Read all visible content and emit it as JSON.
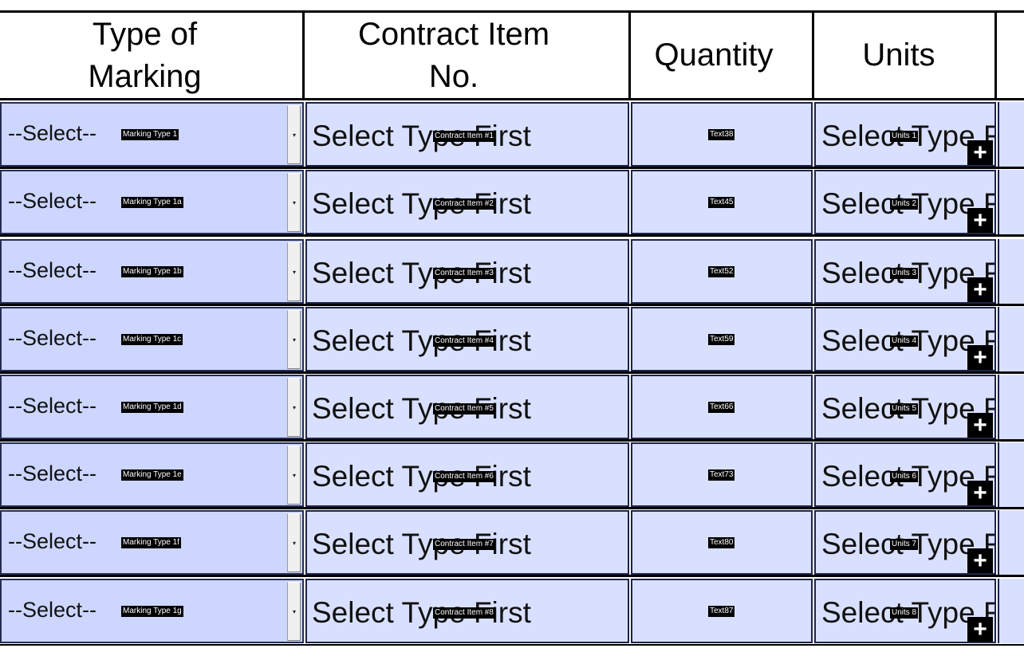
{
  "header": {
    "col_marking": "Type of\nMarking",
    "col_item": "Contract Item\nNo.",
    "col_quantity": "Quantity",
    "col_units": "Units"
  },
  "icons": {
    "dropdown": "chevron-down-icon",
    "add": "plus-icon"
  },
  "colors": {
    "marking_bg": "#ccd6ff",
    "field_bg": "#d9e0ff",
    "border": "#000000"
  },
  "rows": [
    {
      "marking_value": "--Select--",
      "marking_tag": "Marking Type 1",
      "item_placeholder": "Select Type First",
      "item_tag": "Contract Item #1",
      "qty_tag": "Text38",
      "units_placeholder": "Select Type F",
      "units_tag": "Units 1"
    },
    {
      "marking_value": "--Select--",
      "marking_tag": "Marking Type 1a",
      "item_placeholder": "Select Type First",
      "item_tag": "Contract Item #2",
      "qty_tag": "Text45",
      "units_placeholder": "Select Type F",
      "units_tag": "Units 2"
    },
    {
      "marking_value": "--Select--",
      "marking_tag": "Marking Type 1b",
      "item_placeholder": "Select Type First",
      "item_tag": "Contract Item #3",
      "qty_tag": "Text52",
      "units_placeholder": "Select Type F",
      "units_tag": "Units 3"
    },
    {
      "marking_value": "--Select--",
      "marking_tag": "Marking Type 1c",
      "item_placeholder": "Select Type First",
      "item_tag": "Contract Item #4",
      "qty_tag": "Text59",
      "units_placeholder": "Select Type F",
      "units_tag": "Units 4"
    },
    {
      "marking_value": "--Select--",
      "marking_tag": "Marking Type 1d",
      "item_placeholder": "Select Type First",
      "item_tag": "Contract Item #5",
      "qty_tag": "Text66",
      "units_placeholder": "Select Type F",
      "units_tag": "Units 5"
    },
    {
      "marking_value": "--Select--",
      "marking_tag": "Marking Type 1e",
      "item_placeholder": "Select Type First",
      "item_tag": "Contract Item #6",
      "qty_tag": "Text73",
      "units_placeholder": "Select Type F",
      "units_tag": "Units 6"
    },
    {
      "marking_value": "--Select--",
      "marking_tag": "Marking Type 1f",
      "item_placeholder": "Select Type First",
      "item_tag": "Contract Item #7",
      "qty_tag": "Text80",
      "units_placeholder": "Select Type F",
      "units_tag": "Units 7"
    },
    {
      "marking_value": "--Select--",
      "marking_tag": "Marking Type 1g",
      "item_placeholder": "Select Type First",
      "item_tag": "Contract Item #8",
      "qty_tag": "Text87",
      "units_placeholder": "Select Type F",
      "units_tag": "Units 8"
    }
  ]
}
